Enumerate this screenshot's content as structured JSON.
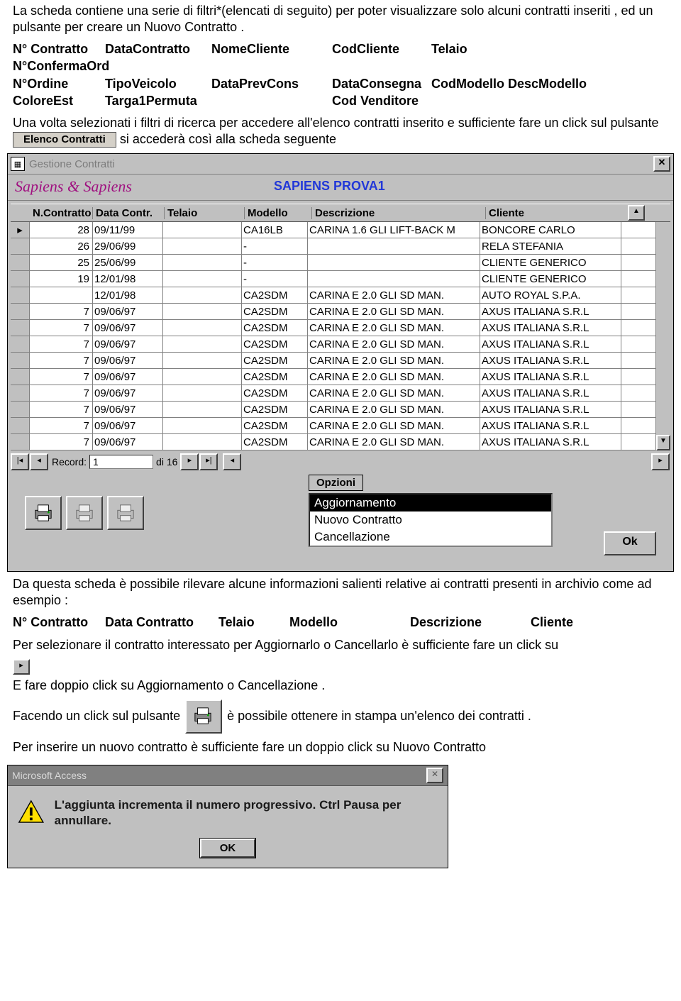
{
  "intro1": "La scheda contiene una serie di filtri*(elencati di seguito) per poter visualizzare solo alcuni contratti inseriti , ed un pulsante per creare un Nuovo Contratto .",
  "filters": {
    "r1c1": "N° Contratto",
    "r1c2": "DataContratto",
    "r1c3": "NomeCliente",
    "r1c4": "CodCliente",
    "r1c5": "Telaio",
    "r2c1": "N°ConfermaOrd",
    "r3c1": "N°Ordine",
    "r3c2": "TipoVeicolo",
    "r3c3": "DataPrevCons",
    "r3c4": "DataConsegna",
    "r3c5": "CodModello DescModello",
    "r4c1": "ColoreEst",
    "r4c2": "Targa1Permuta",
    "r4c3": "Cod Venditore"
  },
  "mid1": "Una volta selezionati i filtri di ricerca per accedere all'elenco contratti inserito e sufficiente fare un click sul pulsante ",
  "btn_elenco": "Elenco Contratti",
  "mid2": " si accederà così alla scheda seguente",
  "window": {
    "title": "Gestione Contratti",
    "brand": "Sapiens & Sapiens",
    "brand2": "SAPIENS PROVA1",
    "headers": {
      "c1": "N.Contratto",
      "c2": "Data Contr.",
      "c3": "Telaio",
      "c4": "Modello",
      "c5": "Descrizione",
      "c6": "Cliente"
    },
    "rows": [
      {
        "n": "28",
        "d": "09/11/99",
        "t": "",
        "m": "CA16LB",
        "desc": "CARINA 1.6 GLI LIFT-BACK M",
        "cli": "BONCORE CARLO"
      },
      {
        "n": "26",
        "d": "29/06/99",
        "t": "",
        "m": "-",
        "desc": "",
        "cli": "RELA STEFANIA"
      },
      {
        "n": "25",
        "d": "25/06/99",
        "t": "",
        "m": "-",
        "desc": "",
        "cli": "CLIENTE GENERICO"
      },
      {
        "n": "19",
        "d": "12/01/98",
        "t": "",
        "m": "-",
        "desc": "",
        "cli": "CLIENTE GENERICO"
      },
      {
        "n": "",
        "d": "12/01/98",
        "t": "",
        "m": "CA2SDM",
        "desc": "CARINA E 2.0 GLI SD MAN.",
        "cli": "AUTO ROYAL S.P.A."
      },
      {
        "n": "7",
        "d": "09/06/97",
        "t": "",
        "m": "CA2SDM",
        "desc": "CARINA E 2.0 GLI SD MAN.",
        "cli": "AXUS ITALIANA S.R.L"
      },
      {
        "n": "7",
        "d": "09/06/97",
        "t": "",
        "m": "CA2SDM",
        "desc": "CARINA E 2.0 GLI SD MAN.",
        "cli": "AXUS ITALIANA S.R.L"
      },
      {
        "n": "7",
        "d": "09/06/97",
        "t": "",
        "m": "CA2SDM",
        "desc": "CARINA E 2.0 GLI SD MAN.",
        "cli": "AXUS ITALIANA S.R.L"
      },
      {
        "n": "7",
        "d": "09/06/97",
        "t": "",
        "m": "CA2SDM",
        "desc": "CARINA E 2.0 GLI SD MAN.",
        "cli": "AXUS ITALIANA S.R.L"
      },
      {
        "n": "7",
        "d": "09/06/97",
        "t": "",
        "m": "CA2SDM",
        "desc": "CARINA E 2.0 GLI SD MAN.",
        "cli": "AXUS ITALIANA S.R.L"
      },
      {
        "n": "7",
        "d": "09/06/97",
        "t": "",
        "m": "CA2SDM",
        "desc": "CARINA E 2.0 GLI SD MAN.",
        "cli": "AXUS ITALIANA S.R.L"
      },
      {
        "n": "7",
        "d": "09/06/97",
        "t": "",
        "m": "CA2SDM",
        "desc": "CARINA E 2.0 GLI SD MAN.",
        "cli": "AXUS ITALIANA S.R.L"
      },
      {
        "n": "7",
        "d": "09/06/97",
        "t": "",
        "m": "CA2SDM",
        "desc": "CARINA E 2.0 GLI SD MAN.",
        "cli": "AXUS ITALIANA S.R.L"
      },
      {
        "n": "7",
        "d": "09/06/97",
        "t": "",
        "m": "CA2SDM",
        "desc": "CARINA E 2.0 GLI SD MAN.",
        "cli": "AXUS ITALIANA S.R.L"
      }
    ],
    "nav": {
      "label": "Record:",
      "value": "1",
      "of": "di 16"
    },
    "options_label": "Opzioni",
    "options": [
      "Aggiornamento",
      "Nuovo Contratto",
      "Cancellazione"
    ],
    "ok": "Ok"
  },
  "para2": "Da questa scheda è possibile rilevare alcune informazioni salienti relative ai contratti presenti in archivio come ad esempio :",
  "cols2": {
    "c1": "N° Contratto",
    "c2": "Data Contratto",
    "c3": "Telaio",
    "c4": "Modello",
    "c5": "Descrizione",
    "c6": "Cliente"
  },
  "para3": "Per selezionare il contratto interessato per Aggiornarlo o Cancellarlo è sufficiente fare un click su",
  "para4": "E fare doppio click su Aggiornamento o Cancellazione .",
  "para5a": "Facendo un click sul pulsante ",
  "para5b": " è possibile ottenere in stampa un'elenco dei contratti .",
  "para6": "Per inserire un nuovo contratto è sufficiente fare un doppio click  su Nuovo Contratto",
  "dialog": {
    "title": "Microsoft Access",
    "msg": "L'aggiunta incrementa il numero progressivo. Ctrl Pausa per annullare.",
    "ok": "OK"
  }
}
